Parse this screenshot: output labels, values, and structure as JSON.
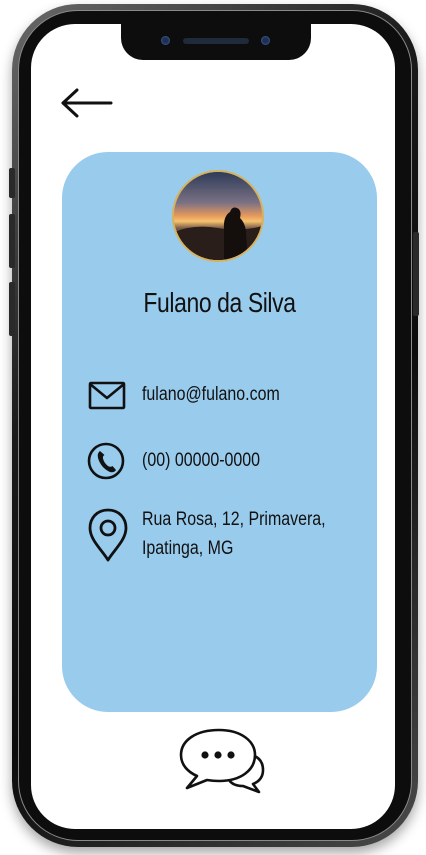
{
  "profile": {
    "name": "Fulano da Silva"
  },
  "contact": {
    "email": "fulano@fulano.com",
    "phone": "(00) 00000-0000",
    "address_line1": "Rua Rosa, 12, Primavera,",
    "address_line2": "Ipatinga, MG"
  },
  "icons": {
    "back": "arrow-left-icon",
    "email": "envelope-icon",
    "phone": "phone-icon",
    "address": "location-pin-icon",
    "chat": "chat-bubbles-icon"
  },
  "colors": {
    "card": "#99cbed",
    "text": "#111111",
    "avatar_ring": "#d8b25a",
    "phone_frame": "#0d0d0d"
  }
}
